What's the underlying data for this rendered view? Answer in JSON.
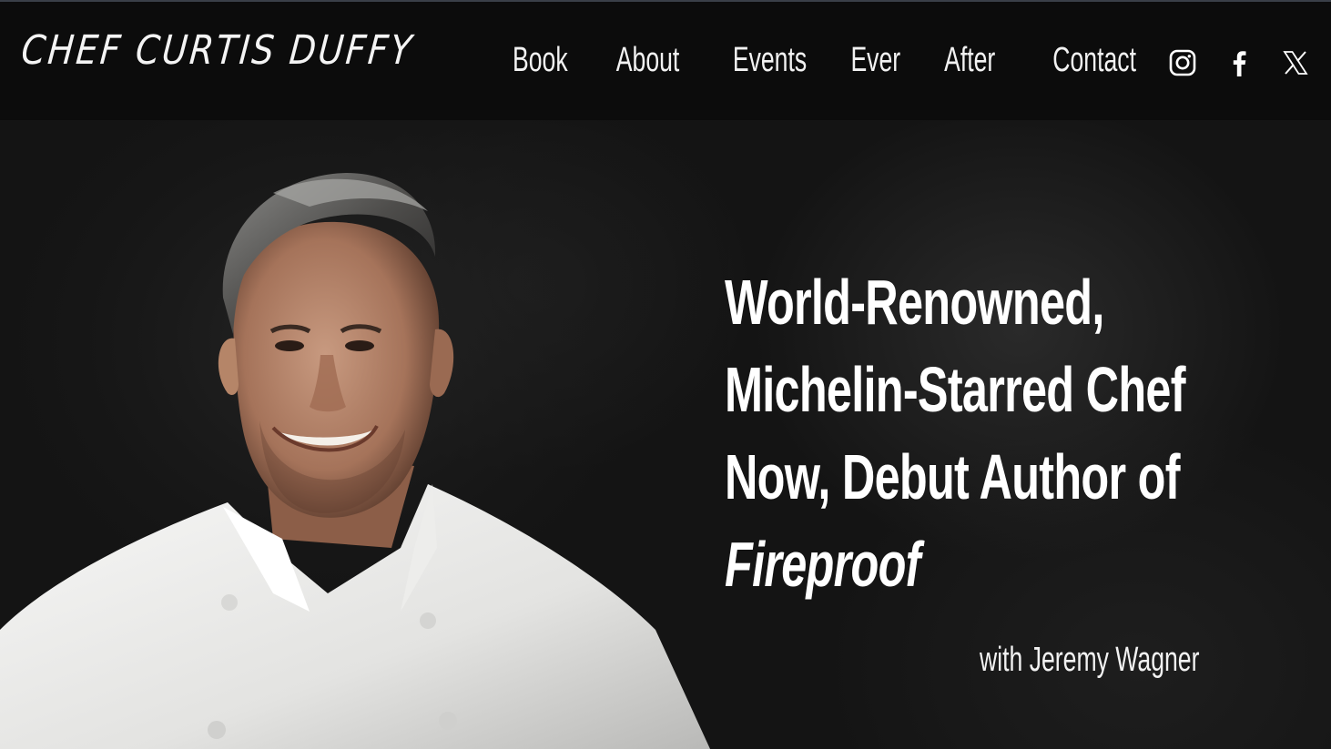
{
  "header": {
    "logo_text": "CHEF CURTIS DUFFY",
    "nav": [
      {
        "label": "Book"
      },
      {
        "label": "About"
      },
      {
        "label": "Events"
      },
      {
        "label": "Ever"
      },
      {
        "label": "After"
      },
      {
        "label": "Contact"
      }
    ],
    "socials": [
      {
        "icon": "instagram-icon"
      },
      {
        "icon": "facebook-icon"
      },
      {
        "icon": "x-twitter-icon"
      }
    ]
  },
  "hero": {
    "headline_lines": [
      "World-Renowned,",
      "Michelin-Starred Chef",
      "Now, Debut Author of"
    ],
    "book_title": "Fireproof",
    "byline": "with Jeremy Wagner"
  },
  "colors": {
    "background": "#0b0b0b",
    "text": "#ffffff"
  }
}
